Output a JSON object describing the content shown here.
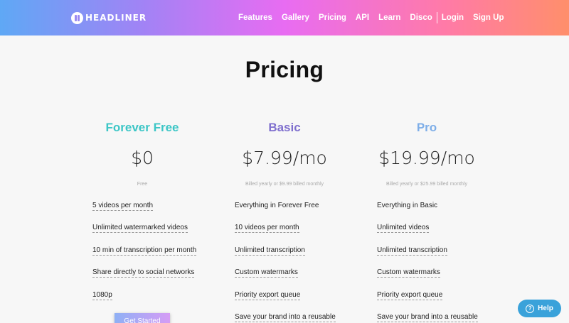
{
  "brand": {
    "name": "HEADLINER",
    "logo_icon": "headliner-logo-icon"
  },
  "nav": {
    "links": [
      "Features",
      "Gallery",
      "Pricing",
      "API",
      "Learn",
      "Disco"
    ],
    "login": "Login",
    "signup": "Sign Up"
  },
  "page": {
    "title": "Pricing"
  },
  "plans": [
    {
      "name": "Forever Free",
      "color": "#3cc6c6",
      "price": "$0",
      "billing": "Free",
      "features": [
        "5 videos per month",
        "Unlimited watermarked videos",
        "10 min of transcription per month",
        "Share directly to social networks",
        "1080p"
      ],
      "cta": "Get Started"
    },
    {
      "name": "Basic",
      "color": "#7f6fce",
      "price": "$7.99/mo",
      "billing": "Billed yearly or $9.99 billed monthly",
      "features": [
        "Everything in Forever Free",
        "10 videos per month",
        "Unlimited transcription",
        "Custom watermarks",
        "Priority export queue",
        "Save your brand into a reusable"
      ]
    },
    {
      "name": "Pro",
      "color": "#7eaee8",
      "price": "$19.99/mo",
      "billing": "Billed yearly or $25.99 billed monthly",
      "features": [
        "Everything in Basic",
        "Unlimited videos",
        "Unlimited transcription",
        "Custom watermarks",
        "Priority export queue",
        "Save your brand into a reusable"
      ]
    }
  ],
  "help": {
    "label": "Help",
    "icon": "question-circle-icon"
  }
}
